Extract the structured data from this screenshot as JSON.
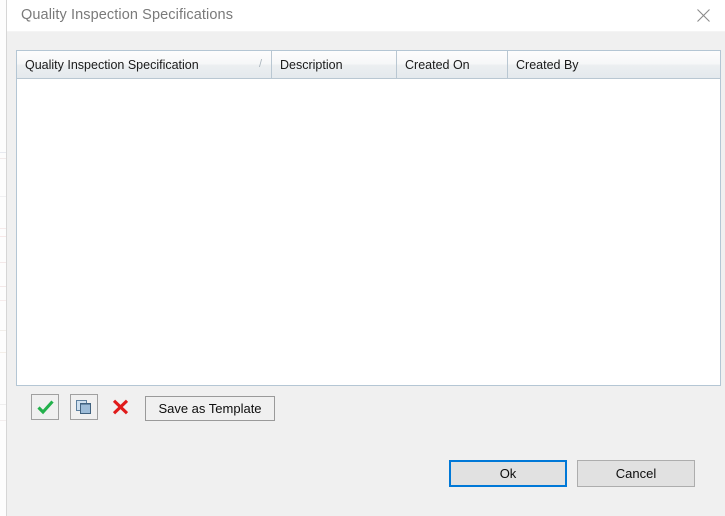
{
  "window": {
    "title": "Quality Inspection Specifications",
    "close_icon": "close-icon",
    "title_color": "#7a7a7a"
  },
  "grid": {
    "columns": [
      {
        "label": "Quality Inspection Specification",
        "sorted": true,
        "sort_glyph": "/"
      },
      {
        "label": "Description",
        "sorted": false
      },
      {
        "label": "Created On",
        "sorted": false
      },
      {
        "label": "Created By",
        "sorted": false
      }
    ],
    "rows": [],
    "empty": true
  },
  "toolbar": {
    "accept_icon": "checkmark-icon",
    "copy_icon": "copy-icon",
    "delete_icon": "red-x-icon",
    "save_template_label": "Save as Template"
  },
  "footer": {
    "ok_label": "Ok",
    "cancel_label": "Cancel",
    "focus_color": "#0078d7"
  }
}
